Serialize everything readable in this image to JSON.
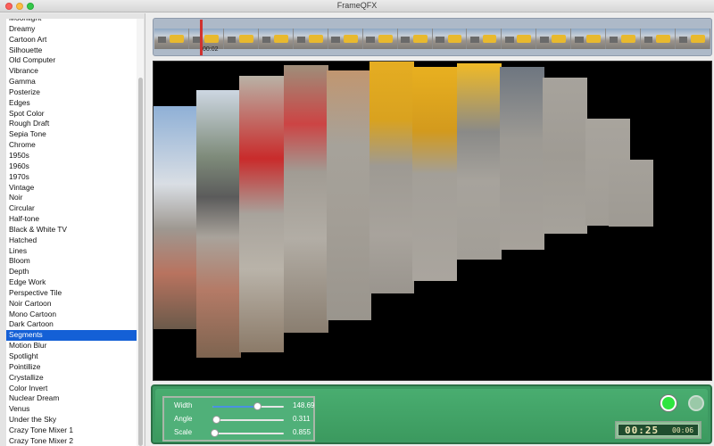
{
  "window": {
    "title": "FrameQFX"
  },
  "sidebar": {
    "items": [
      {
        "label": "Moonlight"
      },
      {
        "label": "Dreamy"
      },
      {
        "label": "Cartoon Art"
      },
      {
        "label": "Silhouette"
      },
      {
        "label": "Old Computer"
      },
      {
        "label": "Vibrance"
      },
      {
        "label": "Gamma"
      },
      {
        "label": "Posterize"
      },
      {
        "label": "Edges"
      },
      {
        "label": "Spot Color"
      },
      {
        "label": "Rough Draft"
      },
      {
        "label": "Sepia Tone"
      },
      {
        "label": "Chrome"
      },
      {
        "label": "1950s"
      },
      {
        "label": "1960s"
      },
      {
        "label": "1970s"
      },
      {
        "label": "Vintage"
      },
      {
        "label": "Noir"
      },
      {
        "label": "Circular"
      },
      {
        "label": "Half-tone"
      },
      {
        "label": "Black & White TV"
      },
      {
        "label": "Hatched"
      },
      {
        "label": "Lines"
      },
      {
        "label": "Bloom"
      },
      {
        "label": "Depth"
      },
      {
        "label": "Edge Work"
      },
      {
        "label": "Perspective Tile"
      },
      {
        "label": "Noir Cartoon"
      },
      {
        "label": "Mono Cartoon"
      },
      {
        "label": "Dark Cartoon"
      },
      {
        "label": "Segments"
      },
      {
        "label": "Motion Blur"
      },
      {
        "label": "Spotlight"
      },
      {
        "label": "Pointillize"
      },
      {
        "label": "Crystallize"
      },
      {
        "label": "Color Invert"
      },
      {
        "label": "Nuclear Dream"
      },
      {
        "label": "Venus"
      },
      {
        "label": "Under the Sky"
      },
      {
        "label": "Crazy Tone Mixer 1"
      },
      {
        "label": "Crazy Tone Mixer 2"
      }
    ],
    "selected": "Segments"
  },
  "timeline": {
    "playhead_time": "00:02",
    "frame_count": 16
  },
  "preview": {
    "description_icon": "video-preview"
  },
  "controls": {
    "params": [
      {
        "label": "Width",
        "value": "148.69",
        "fraction": 0.62
      },
      {
        "label": "Angle",
        "value": "0.311",
        "fraction": 0.05
      },
      {
        "label": "Scale",
        "value": "0.855",
        "fraction": 0.03
      }
    ],
    "clock_main": "00:25",
    "clock_small": "00:06"
  },
  "colors": {
    "selection": "#1460d6",
    "panel_green": "#3d9a62",
    "playhead": "#d0312e"
  }
}
